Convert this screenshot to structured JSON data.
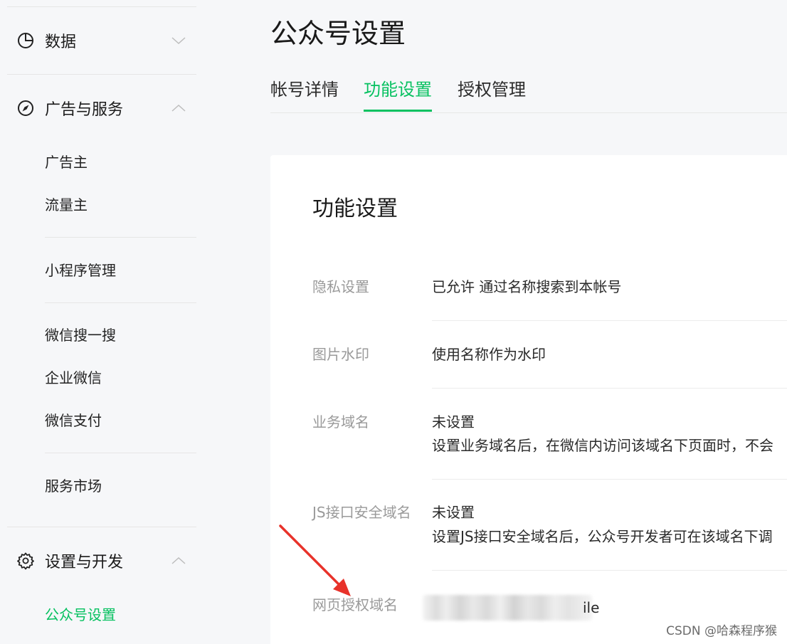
{
  "sidebar": {
    "groups": [
      {
        "label": "数据",
        "icon": "pie-chart-icon",
        "expanded": false
      },
      {
        "label": "广告与服务",
        "icon": "compass-icon",
        "expanded": true
      },
      {
        "label": "设置与开发",
        "icon": "gear-icon",
        "expanded": true
      }
    ],
    "items": {
      "advertiser": "广告主",
      "publisher": "流量主",
      "mini_program": "小程序管理",
      "wechat_search": "微信搜一搜",
      "wecom": "企业微信",
      "wechat_pay": "微信支付",
      "service_market": "服务市场",
      "oa_settings": "公众号设置"
    }
  },
  "page": {
    "title": "公众号设置",
    "tabs": [
      "帐号详情",
      "功能设置",
      "授权管理"
    ],
    "active_tab": 1
  },
  "card": {
    "title": "功能设置",
    "rows": [
      {
        "label": "隐私设置",
        "value": "已允许 通过名称搜索到本帐号"
      },
      {
        "label": "图片水印",
        "value": "使用名称作为水印"
      },
      {
        "label": "业务域名",
        "value": "未设置",
        "desc": "设置业务域名后，在微信内访问该域名下页面时，不会"
      },
      {
        "label": "JS接口安全域名",
        "value": "未设置",
        "desc": "设置JS接口安全域名后，公众号开发者可在该域名下调"
      },
      {
        "label": "网页授权域名",
        "value_suffix": "ile"
      }
    ]
  },
  "watermark": "CSDN @哈森程序猴",
  "colors": {
    "accent": "#07c160",
    "arrow": "#e8322a"
  }
}
